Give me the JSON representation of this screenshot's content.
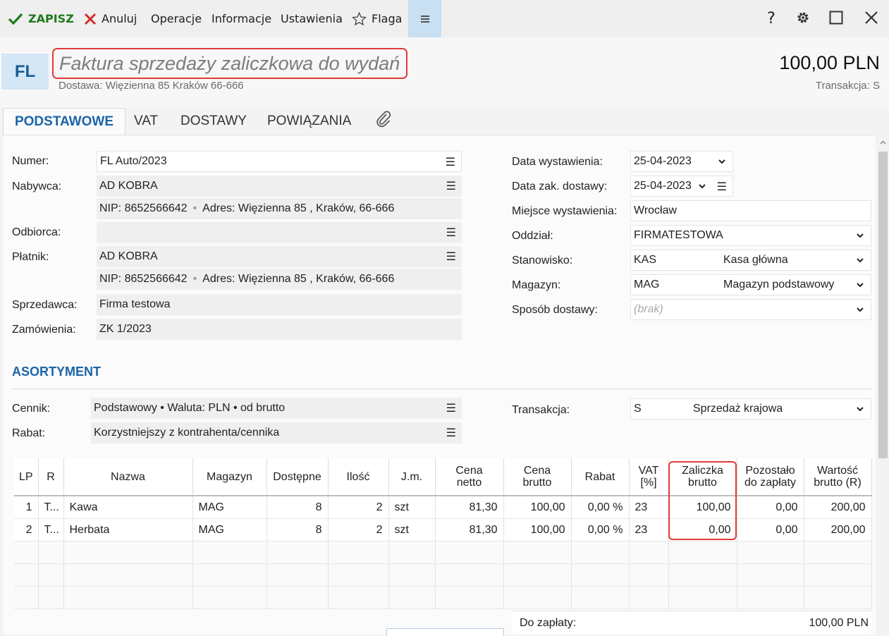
{
  "toolbar": {
    "save": "ZAPISZ",
    "cancel": "Anuluj",
    "operations": "Operacje",
    "information": "Informacje",
    "settings": "Ustawienia",
    "flag": "Flaga",
    "help": "?"
  },
  "header": {
    "badge": "FL",
    "title": "Faktura sprzedaży zaliczkowa do wydań",
    "subtitle": "Dostawa: Więzienna  85  Kraków 66-666",
    "amount": "100,00 PLN",
    "transaction": "Transakcja:  S"
  },
  "tabs": {
    "basic": "PODSTAWOWE",
    "vat": "VAT",
    "deliveries": "DOSTAWY",
    "relations": "POWIĄZANIA"
  },
  "left": {
    "numer_label": "Numer:",
    "numer": "FL Auto/2023",
    "nabywca_label": "Nabywca:",
    "nabywca": "AD KOBRA",
    "nabywca_nip_label": "NIP:",
    "nabywca_nip": "8652566642",
    "nabywca_addr_label": "Adres:",
    "nabywca_addr": "Więzienna  85 , Kraków, 66-666",
    "odbiorca_label": "Odbiorca:",
    "odbiorca": "",
    "platnik_label": "Płatnik:",
    "platnik": "AD KOBRA",
    "platnik_nip_label": "NIP:",
    "platnik_nip": "8652566642",
    "platnik_addr_label": "Adres:",
    "platnik_addr": "Więzienna  85 , Kraków, 66-666",
    "sprzedawca_label": "Sprzedawca:",
    "sprzedawca": "Firma testowa",
    "zamowienia_label": "Zamówienia:",
    "zamowienia": "ZK 1/2023",
    "dot": "•"
  },
  "right": {
    "data_wyst_label": "Data wystawienia:",
    "data_wyst": "25-04-2023",
    "data_zak_label": "Data zak. dostawy:",
    "data_zak": "25-04-2023",
    "miejsce_label": "Miejsce wystawienia:",
    "miejsce": "Wrocław",
    "oddzial_label": "Oddział:",
    "oddzial": "FIRMATESTOWA",
    "stanowisko_label": "Stanowisko:",
    "stanowisko_code": "KAS",
    "stanowisko_name": "Kasa główna",
    "magazyn_label": "Magazyn:",
    "magazyn_code": "MAG",
    "magazyn_name": "Magazyn podstawowy",
    "sposob_label": "Sposób dostawy:",
    "sposob_placeholder": "(brak)"
  },
  "assortment": {
    "title": "ASORTYMENT",
    "cennik_label": "Cennik:",
    "cennik": "Podstawowy • Waluta: PLN • od brutto",
    "rabat_label": "Rabat:",
    "rabat": "Korzystniejszy z kontrahenta/cennika",
    "transakcja_label": "Transakcja:",
    "transakcja_code": "S",
    "transakcja_name": "Sprzedaż krajowa"
  },
  "table": {
    "headers": {
      "lp": "LP",
      "r": "R",
      "nazwa": "Nazwa",
      "magazyn": "Magazyn",
      "dostepne": "Dostępne",
      "ilosc": "Ilość",
      "jm": "J.m.",
      "cena_netto_1": "Cena",
      "cena_netto_2": "netto",
      "cena_brutto_1": "Cena",
      "cena_brutto_2": "brutto",
      "rabat": "Rabat",
      "vat_1": "VAT",
      "vat_2": "[%]",
      "zaliczka_1": "Zaliczka",
      "zaliczka_2": "brutto",
      "pozostalo_1": "Pozostało",
      "pozostalo_2": "do zapłaty",
      "wartosc_1": "Wartość",
      "wartosc_2": "brutto (R)"
    },
    "rows": [
      {
        "lp": "1",
        "r": "T...",
        "nazwa": "Kawa",
        "magazyn": "MAG",
        "dostepne": "8",
        "ilosc": "2",
        "jm": "szt",
        "cena_netto": "81,30",
        "cena_brutto": "100,00",
        "rabat": "0,00 %",
        "vat": "23",
        "zaliczka": "100,00",
        "pozostalo": "0,00",
        "wartosc": "200,00"
      },
      {
        "lp": "2",
        "r": "T...",
        "nazwa": "Herbata",
        "magazyn": "MAG",
        "dostepne": "8",
        "ilosc": "2",
        "jm": "szt",
        "cena_netto": "81,30",
        "cena_brutto": "100,00",
        "rabat": "0,00 %",
        "vat": "23",
        "zaliczka": "0,00",
        "pozostalo": "0,00",
        "wartosc": "200,00"
      }
    ]
  },
  "summary": {
    "label": "Do zapłaty:",
    "value": "100,00 PLN"
  },
  "icons": {
    "save": "check-icon",
    "cancel": "x-icon",
    "flag": "star-icon",
    "menu": "hamburger-icon",
    "help": "question-icon",
    "gear": "gear-icon",
    "maximize": "square-icon",
    "close": "close-icon",
    "attachment": "paperclip-icon"
  },
  "colors": {
    "accent": "#1a65a8",
    "save_green": "#1e7a1e",
    "cancel_red": "#d32f2f",
    "highlight_red": "#e23a3a",
    "menu_bg": "#c9dff2"
  }
}
